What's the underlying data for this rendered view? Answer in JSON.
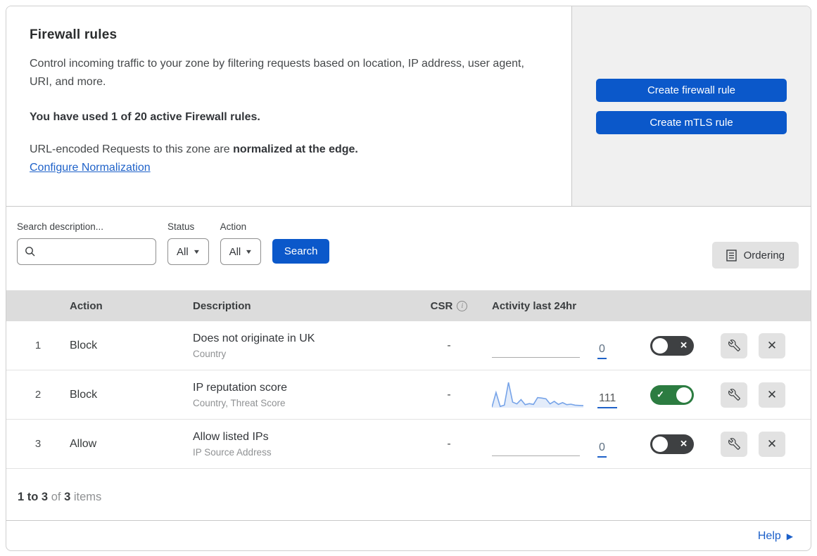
{
  "header": {
    "title": "Firewall rules",
    "description": "Control incoming traffic to your zone by filtering requests based on location, IP address, user agent, URI, and more.",
    "usage_text": "You have used 1 of 20 active Firewall rules.",
    "normalization_prefix": "URL-encoded Requests to this zone are ",
    "normalization_bold": "normalized at the edge.",
    "normalization_link": "Configure Normalization",
    "buttons": {
      "create_firewall": "Create firewall rule",
      "create_mtls": "Create mTLS rule"
    }
  },
  "filters": {
    "search_label": "Search description...",
    "status_label": "Status",
    "status_value": "All",
    "action_label": "Action",
    "action_value": "All",
    "search_button": "Search",
    "ordering_button": "Ordering"
  },
  "table": {
    "columns": {
      "action": "Action",
      "description": "Description",
      "csr": "CSR",
      "activity": "Activity last 24hr"
    },
    "rows": [
      {
        "index": "1",
        "action": "Block",
        "description": "Does not originate in UK",
        "fields": "Country",
        "csr": "-",
        "activity_count": "0",
        "enabled": false,
        "sparkline": []
      },
      {
        "index": "2",
        "action": "Block",
        "description": "IP reputation score",
        "fields": "Country, Threat Score",
        "csr": "-",
        "activity_count": "111",
        "enabled": true,
        "sparkline": [
          2,
          60,
          5,
          10,
          100,
          22,
          15,
          32,
          12,
          16,
          13,
          40,
          38,
          35,
          15,
          25,
          13,
          20,
          12,
          14,
          10,
          9,
          8
        ]
      },
      {
        "index": "3",
        "action": "Allow",
        "description": "Allow listed IPs",
        "fields": "IP Source Address",
        "csr": "-",
        "activity_count": "0",
        "enabled": false,
        "sparkline": []
      }
    ]
  },
  "footer": {
    "range": "1 to 3",
    "of_label": "of",
    "total": "3",
    "items_label": "items",
    "help": "Help"
  },
  "colors": {
    "button_blue": "#0b58ca",
    "link_blue": "#1f62c9",
    "toggle_on_green": "#2c7c41",
    "toggle_off_gray": "#3e4042",
    "panel_gray": "#f0f0f0",
    "table_header_gray": "#dcdcdc",
    "sparkline_blue": "#76a3e8"
  }
}
